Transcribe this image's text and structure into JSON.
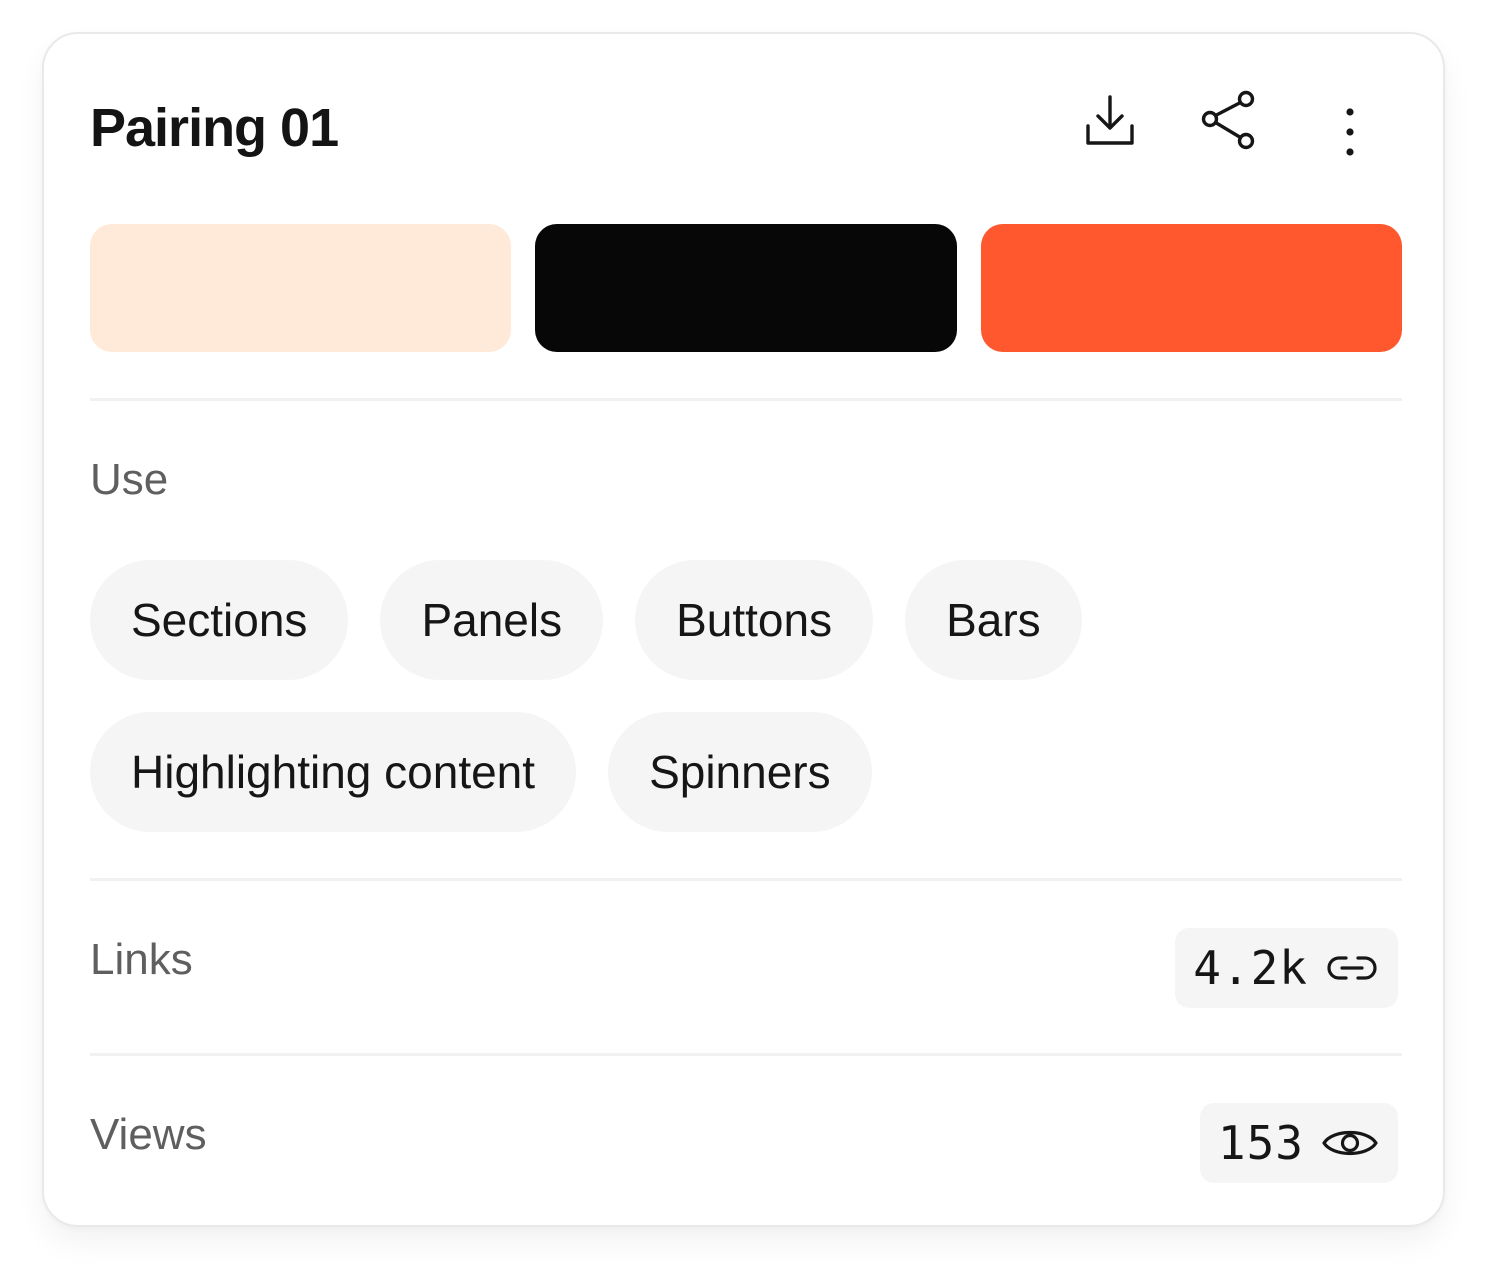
{
  "card": {
    "title": "Pairing 01",
    "actions": {
      "download_icon": "download-icon",
      "share_icon": "share-icon",
      "more_icon": "more-vertical-icon"
    },
    "swatches": [
      {
        "color": "#FFEAD9"
      },
      {
        "color": "#070707"
      },
      {
        "color": "#FF572E"
      }
    ],
    "use": {
      "label": "Use",
      "tags": [
        "Sections",
        "Panels",
        "Buttons",
        "Bars",
        "Highlighting content",
        "Spinners"
      ]
    },
    "links": {
      "label": "Links",
      "value": "4.2k",
      "icon": "link-icon"
    },
    "views": {
      "label": "Views",
      "value": "153",
      "icon": "eye-icon"
    }
  }
}
